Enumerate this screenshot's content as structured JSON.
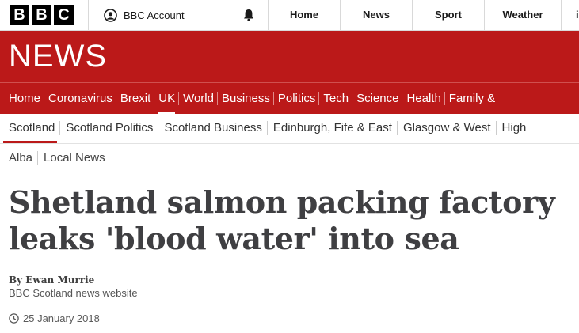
{
  "global_nav": {
    "logo_letters": [
      "B",
      "B",
      "C"
    ],
    "account_label": "BBC Account",
    "links": [
      "Home",
      "News",
      "Sport",
      "Weather",
      "i"
    ]
  },
  "banner": {
    "title": "NEWS",
    "color": "#bb1919"
  },
  "main_nav": {
    "items": [
      "Home",
      "Coronavirus",
      "Brexit",
      "UK",
      "World",
      "Business",
      "Politics",
      "Tech",
      "Science",
      "Health",
      "Family &"
    ],
    "active": "UK"
  },
  "sub_nav": {
    "items": [
      "Scotland",
      "Scotland Politics",
      "Scotland Business",
      "Edinburgh, Fife & East",
      "Glasgow & West",
      "High"
    ],
    "active": "Scotland"
  },
  "tertiary_nav": {
    "items": [
      "Alba",
      "Local News"
    ]
  },
  "article": {
    "headline_line1": "Shetland salmon packing factory",
    "headline_line2": "leaks 'blood water' into sea",
    "author": "By Ewan Murrie",
    "author_role": "BBC Scotland news website",
    "date": "25 January 2018"
  },
  "icons": {
    "account": "user-circle-icon",
    "notifications": "bell-icon",
    "date": "clock-icon"
  }
}
